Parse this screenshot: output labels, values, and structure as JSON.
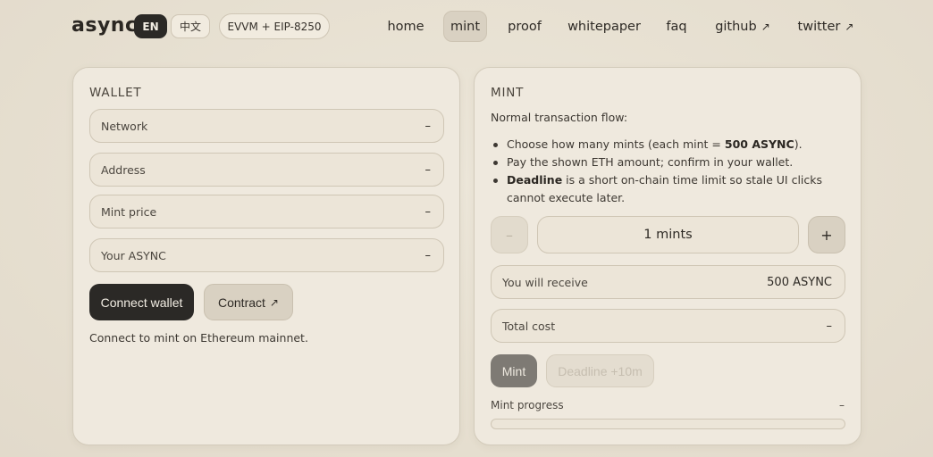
{
  "header": {
    "brand": "async",
    "lang_en": "EN",
    "lang_zh": "中文",
    "chain": "EVVM + EIP-8250",
    "nav": [
      {
        "label": "home"
      },
      {
        "label": "mint",
        "active": true
      },
      {
        "label": "proof"
      },
      {
        "label": "whitepaper"
      },
      {
        "label": "faq"
      },
      {
        "label": "github",
        "external": true
      },
      {
        "label": "twitter",
        "external": true
      }
    ],
    "external_glyph": "↗"
  },
  "wallet": {
    "title": "WALLET",
    "fields": [
      {
        "label": "Network",
        "value": "–"
      },
      {
        "label": "Address",
        "value": "–"
      },
      {
        "label": "Mint price",
        "value": "–"
      },
      {
        "label": "Your ASYNC",
        "value": "–"
      }
    ],
    "connect_label": "Connect wallet",
    "contract_label": "Contract",
    "hint": "Connect to mint on Ethereum mainnet."
  },
  "mint": {
    "title": "MINT",
    "intro": "Normal transaction flow:",
    "bullets": {
      "b1_pre": "Choose how many mints (each mint = ",
      "b1_bold": "500 ASYNC",
      "b1_post": ").",
      "b2": "Pay the shown ETH amount; confirm in your wallet.",
      "b3_bold": "Deadline",
      "b3_post": " is a short on-chain time limit so stale UI clicks cannot execute later."
    },
    "minus": "–",
    "plus": "+",
    "quantity": "1 mints",
    "receive_label": "You will receive",
    "receive_value": "500 ASYNC",
    "cost_label": "Total cost",
    "cost_value": "–",
    "mint_button": "Mint",
    "deadline_button": "Deadline +10m",
    "progress_label": "Mint progress",
    "progress_value": "–",
    "progress_fraction": 0
  },
  "colors": {
    "background": "#e7e0d2",
    "card": "#efe9de",
    "dark_button": "#2b2926",
    "disabled_mint": "#7e7a74"
  }
}
